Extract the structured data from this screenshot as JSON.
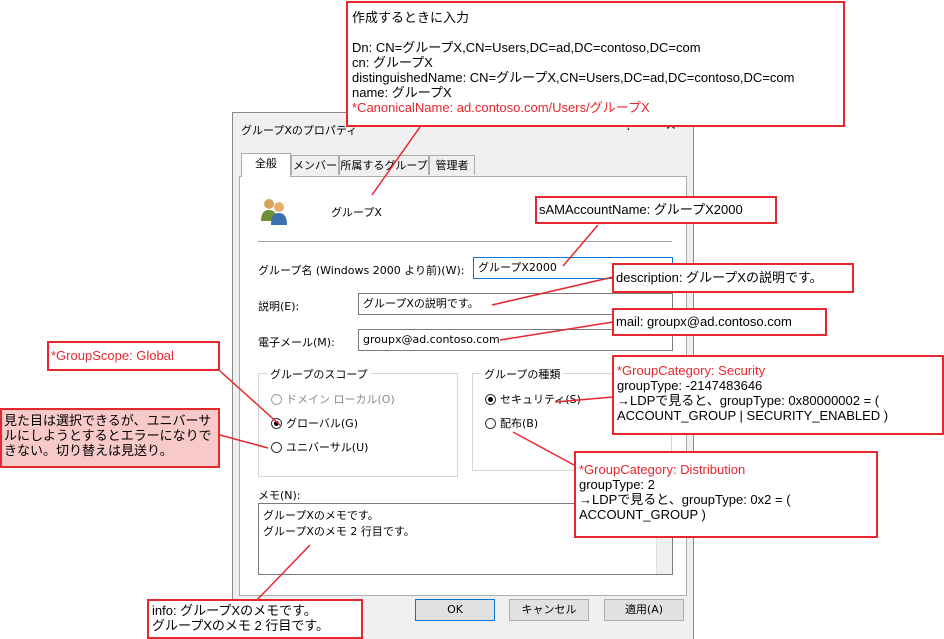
{
  "dialog": {
    "title": "グループXのプロパティ",
    "help_glyph": "?",
    "close_glyph": "✕",
    "tabs": [
      "全般",
      "メンバー",
      "所属するグループ",
      "管理者"
    ],
    "group_icon": "group-users-icon",
    "group_name_display": "グループX",
    "fields": {
      "pre2000_label": "グループ名 (Windows 2000 より前)(W):",
      "pre2000_value": "グループX2000",
      "description_label": "説明(E):",
      "description_value": "グループXの説明です。",
      "email_label": "電子メール(M):",
      "email_value": "groupx@ad.contoso.com"
    },
    "scope": {
      "title": "グループのスコープ",
      "options": [
        {
          "label": "ドメイン ローカル(O)",
          "checked": false,
          "disabled": true
        },
        {
          "label": "グローバル(G)",
          "checked": true,
          "disabled": false
        },
        {
          "label": "ユニバーサル(U)",
          "checked": false,
          "disabled": false
        }
      ]
    },
    "type": {
      "title": "グループの種類",
      "options": [
        {
          "label": "セキュリティ(S)",
          "checked": true
        },
        {
          "label": "配布(B)",
          "checked": false
        }
      ]
    },
    "memo_label": "メモ(N):",
    "memo_lines": [
      "グループXのメモです。",
      "グループXのメモ 2 行目です。"
    ],
    "buttons": {
      "ok": "OK",
      "cancel": "キャンセル",
      "apply": "適用(A)"
    }
  },
  "annotations": {
    "top": {
      "heading": "作成するときに入力",
      "lines": [
        "Dn: CN=グループX,CN=Users,DC=ad,DC=contoso,DC=com",
        "cn: グループX",
        "distinguishedName: CN=グループX,CN=Users,DC=ad,DC=contoso,DC=com",
        "name: グループX"
      ],
      "red_line": "*CanonicalName: ad.contoso.com/Users/グループX"
    },
    "sam": "sAMAccountName: グループX2000",
    "description": "description: グループXの説明です。",
    "mail": "mail: groupx@ad.contoso.com",
    "group_scope": "*GroupScope: Global",
    "universal_note": "見た目は選択できるが、ユニバーサルにしようとするとエラーになりできない。切り替えは見送り。",
    "security": {
      "red_line": "*GroupCategory: Security",
      "lines": [
        "groupType: -2147483646",
        "→LDPで見ると、groupType: 0x80000002 = (",
        "ACCOUNT_GROUP | SECURITY_ENABLED )"
      ]
    },
    "distribution": {
      "red_line": "*GroupCategory: Distribution",
      "lines": [
        "groupType: 2",
        "→LDPで見ると、groupType: 0x2 = (",
        "ACCOUNT_GROUP )"
      ]
    },
    "info": {
      "lines": [
        "info: グループXのメモです。",
        "グループXのメモ 2 行目です。"
      ]
    }
  },
  "colors": {
    "annotation_red": "#e8262d",
    "pink_fill": "#f8c9c9",
    "dialog_bg": "#f0f0f0",
    "accent": "#0078d7"
  }
}
